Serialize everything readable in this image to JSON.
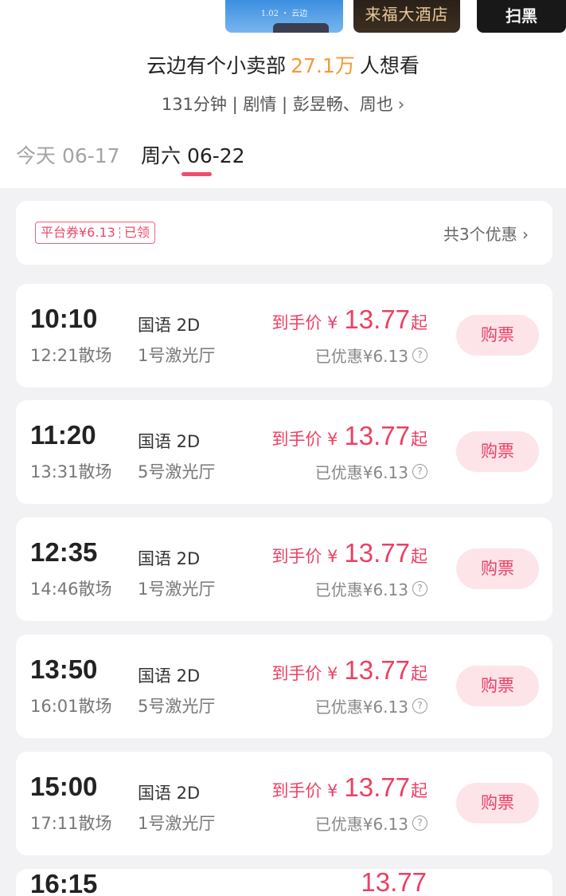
{
  "posters": [
    {
      "caption": "1.02 ・ 云边"
    },
    {
      "caption": "来福大酒店"
    },
    {
      "caption": "扫黑"
    }
  ],
  "movie": {
    "title": "云边有个小卖部",
    "want_count": "27.1万",
    "want_suffix": "人想看",
    "meta": "131分钟 | 剧情 | 彭昱畅、周也",
    "meta_chevron": "›"
  },
  "date_tabs": [
    {
      "label": "今天 06-17"
    },
    {
      "label": "周六 06-22"
    }
  ],
  "coupon": {
    "badge": "平台券¥6.13",
    "status": "已领",
    "more": "共3个优惠 ›"
  },
  "sessions": [
    {
      "start": "10:10",
      "end": "12:21散场",
      "lang": "国语 2D",
      "hall": "1号激光厅",
      "price_label": "到手价 ¥",
      "price": "13.77",
      "price_suffix": "起",
      "discount": "已优惠¥6.13",
      "buy": "购票"
    },
    {
      "start": "11:20",
      "end": "13:31散场",
      "lang": "国语 2D",
      "hall": "5号激光厅",
      "price_label": "到手价 ¥",
      "price": "13.77",
      "price_suffix": "起",
      "discount": "已优惠¥6.13",
      "buy": "购票"
    },
    {
      "start": "12:35",
      "end": "14:46散场",
      "lang": "国语 2D",
      "hall": "1号激光厅",
      "price_label": "到手价 ¥",
      "price": "13.77",
      "price_suffix": "起",
      "discount": "已优惠¥6.13",
      "buy": "购票"
    },
    {
      "start": "13:50",
      "end": "16:01散场",
      "lang": "国语 2D",
      "hall": "5号激光厅",
      "price_label": "到手价 ¥",
      "price": "13.77",
      "price_suffix": "起",
      "discount": "已优惠¥6.13",
      "buy": "购票"
    },
    {
      "start": "15:00",
      "end": "17:11散场",
      "lang": "国语 2D",
      "hall": "1号激光厅",
      "price_label": "到手价 ¥",
      "price": "13.77",
      "price_suffix": "起",
      "discount": "已优惠¥6.13",
      "buy": "购票"
    },
    {
      "start": "16:15",
      "end": "",
      "lang": "",
      "hall": "",
      "price_label": "",
      "price": "13.77",
      "price_suffix": "",
      "discount": "",
      "buy": ""
    }
  ],
  "icons": {
    "question": "?"
  },
  "colors": {
    "accent": "#ec3f63",
    "want": "#f29b38",
    "button_bg": "#fde4e9",
    "page_bg": "#f2f2f4"
  }
}
